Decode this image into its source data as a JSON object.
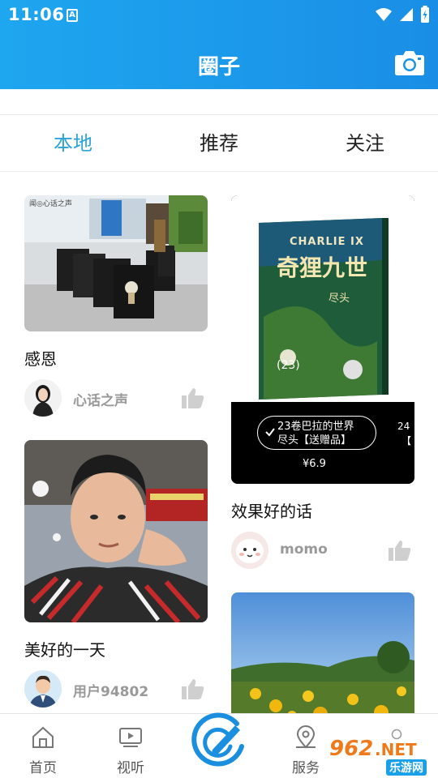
{
  "status_bar": {
    "time": "11:06",
    "a_icon_label": "A"
  },
  "header": {
    "title": "圈子",
    "camera_icon": "camera-icon"
  },
  "tabs": [
    {
      "label": "本地",
      "active": true
    },
    {
      "label": "推荐",
      "active": false
    },
    {
      "label": "关注",
      "active": false
    }
  ],
  "feed": {
    "left": [
      {
        "title": "感恩",
        "author": "心话之声",
        "image_caption": "闻◎心话之声"
      },
      {
        "title": "美好的一天",
        "author": "用户94802"
      }
    ],
    "right": [
      {
        "title": "效果好的话",
        "author": "momo",
        "book_title": "奇狸九世",
        "book_brand": "CHARLIE IX",
        "book_subtitle": "尽头",
        "book_volume": "(23)",
        "tag_text_line1": "23卷巴拉的世界",
        "tag_text_line2": "尽头【送赠品】",
        "tag_side_number": "24",
        "tag_side_bracket": "【",
        "price": "¥6.9"
      },
      {
        "title": ""
      }
    ]
  },
  "bottom_nav": {
    "items": [
      {
        "label": "首页",
        "icon": "home-icon"
      },
      {
        "label": "视听",
        "icon": "video-icon"
      },
      {
        "label": "服务",
        "icon": "location-icon"
      }
    ],
    "center_icon": "publish-icon",
    "watermark_number": "962",
    "watermark_suffix": ".NET",
    "watermark_text": "乐游网"
  },
  "colors": {
    "header": "#1a94e9",
    "active_tab": "#2aa3d8",
    "author_gray": "#999999"
  }
}
